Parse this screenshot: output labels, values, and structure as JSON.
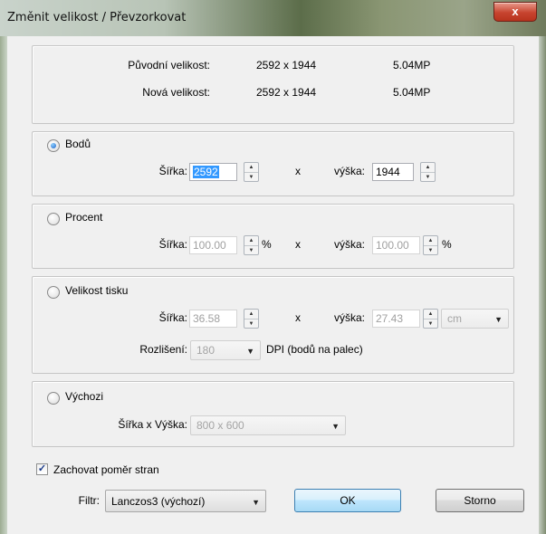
{
  "window": {
    "title": "Změnit velikost / Převzorkovat",
    "close_glyph": "x"
  },
  "info": {
    "original_label": "Původní velikost:",
    "original_size": "2592 x 1944",
    "original_mp": "5.04MP",
    "new_label": "Nová velikost:",
    "new_size": "2592 x 1944",
    "new_mp": "5.04MP"
  },
  "pixels": {
    "label": "Bodů",
    "selected": true,
    "width_label": "Šířka:",
    "width_value": "2592",
    "x": "x",
    "height_label": "výška:",
    "height_value": "1944"
  },
  "percent": {
    "label": "Procent",
    "selected": false,
    "width_label": "Šířka:",
    "width_value": "100.00",
    "width_unit": "%",
    "x": "x",
    "height_label": "výška:",
    "height_value": "100.00",
    "height_unit": "%"
  },
  "print": {
    "label": "Velikost tisku",
    "selected": false,
    "width_label": "Šířka:",
    "width_value": "36.58",
    "x": "x",
    "height_label": "výška:",
    "height_value": "27.43",
    "unit_value": "cm",
    "resolution_label": "Rozlišení:",
    "resolution_value": "180",
    "dpi_label": "DPI (bodů na palec)"
  },
  "preset": {
    "label": "Výchozi",
    "selected": false,
    "size_label": "Šířka x Výška:",
    "size_value": "800 x 600"
  },
  "keep_ratio": {
    "label": "Zachovat poměr stran",
    "checked": true,
    "check_glyph": "✓"
  },
  "filter": {
    "label": "Filtr:",
    "value": "Lanczos3 (výchozí)"
  },
  "buttons": {
    "ok": "OK",
    "cancel": "Storno"
  },
  "glyphs": {
    "up": "▲",
    "down": "▼",
    "dropdown": "▼"
  }
}
